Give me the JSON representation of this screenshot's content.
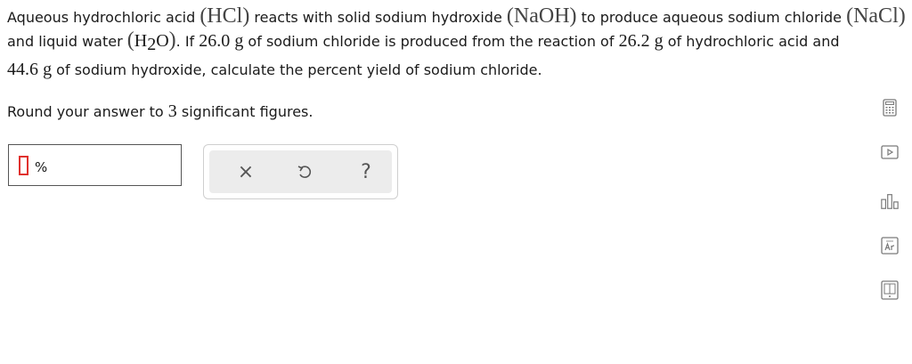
{
  "question": {
    "s1": "Aqueous hydrochloric acid ",
    "hcl": "(HCl)",
    "s2": " reacts with solid sodium hydroxide ",
    "naoh": "(NaOH)",
    "s3": " to produce aqueous sodium chloride ",
    "nacl": "(NaCl)",
    "s4": "and liquid water ",
    "h2o_open": "(",
    "h2o_h": "H",
    "h2o_sub": "2",
    "h2o_o": "O",
    "h2o_close": ")",
    "s5": ". If ",
    "mass_nacl": "26.0",
    "unit_g1": "g",
    "s6": " of sodium chloride is produced from the reaction of ",
    "mass_hcl": "26.2",
    "unit_g2": "g",
    "s7": " of hydrochloric acid and",
    "mass_naoh": "44.6",
    "unit_g3": "g",
    "s8": " of sodium hydroxide, calculate the percent yield of sodium chloride."
  },
  "round": {
    "before": "Round your answer to ",
    "num": "3",
    "after": " significant figures."
  },
  "answer": {
    "value": "",
    "unit": "%"
  },
  "actions": {
    "clear_symbol": "×",
    "undo_symbol": "↺",
    "help_symbol": "?"
  },
  "colors": {
    "cursor_border": "#e0312e",
    "panel_bg": "#ececec",
    "tool_color": "#7a7a7a"
  },
  "tools": [
    "calculator-icon",
    "video-icon",
    "chart-icon",
    "periodic-table-icon",
    "reference-book-icon"
  ]
}
